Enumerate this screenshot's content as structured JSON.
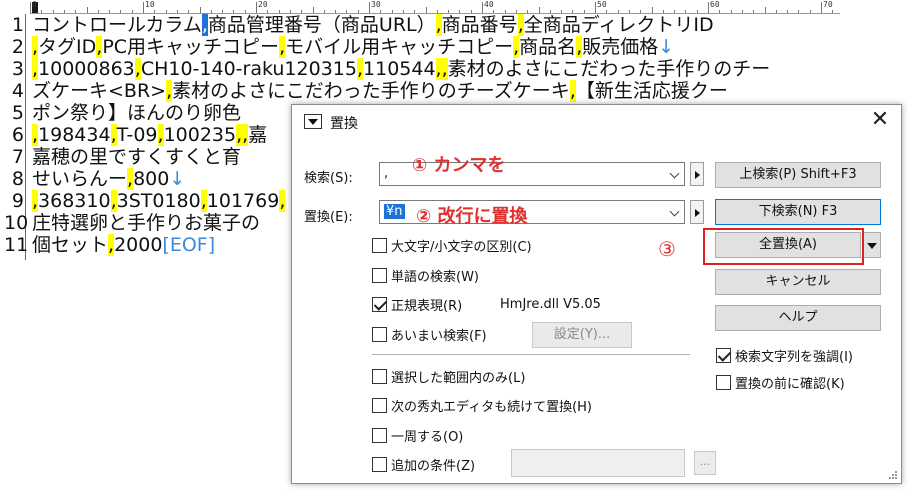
{
  "editor": {
    "ruler_labels": [
      "0",
      "10",
      "20",
      "30",
      "40",
      "50",
      "60",
      "70"
    ],
    "line_numbers": [
      "1",
      "2",
      "3",
      "4",
      "5",
      "6",
      "7",
      "8",
      "9",
      "10",
      "11"
    ],
    "lines": [
      [
        {
          "t": "コントロールカラム"
        },
        {
          "t": ",",
          "c": "sel"
        },
        {
          "t": "商品管理番号（商品URL）"
        },
        {
          "t": ",",
          "c": "hl"
        },
        {
          "t": "商品番号"
        },
        {
          "t": ",",
          "c": "hl"
        },
        {
          "t": "全商品ディレクトリID"
        }
      ],
      [
        {
          "t": ",",
          "c": "hl"
        },
        {
          "t": "タグID"
        },
        {
          "t": ",",
          "c": "hl"
        },
        {
          "t": "PC用キャッチコピー"
        },
        {
          "t": ",",
          "c": "hl"
        },
        {
          "t": "モバイル用キャッチコピー"
        },
        {
          "t": ",",
          "c": "hl"
        },
        {
          "t": "商品名"
        },
        {
          "t": ",",
          "c": "hl"
        },
        {
          "t": "販売価格"
        },
        {
          "t": "↓",
          "c": "nl"
        }
      ],
      [
        {
          "t": ",",
          "c": "hl"
        },
        {
          "t": "10000863"
        },
        {
          "t": ",",
          "c": "hl"
        },
        {
          "t": "CH10-140-raku120315"
        },
        {
          "t": ",",
          "c": "hl"
        },
        {
          "t": "110544"
        },
        {
          "t": ",",
          "c": "hl"
        },
        {
          "t": ",",
          "c": "hl"
        },
        {
          "t": "素材のよさにこだわった手作りのチー"
        }
      ],
      [
        {
          "t": "ズケーキ<BR>"
        },
        {
          "t": ",",
          "c": "hl"
        },
        {
          "t": "素材のよさにこだわった手作りのチーズケーキ"
        },
        {
          "t": ",",
          "c": "hl"
        },
        {
          "t": "【新生活応援クー"
        }
      ],
      [
        {
          "t": "ポン祭り】ほんのり卵色"
        }
      ],
      [
        {
          "t": ",",
          "c": "hl"
        },
        {
          "t": "198434"
        },
        {
          "t": ",",
          "c": "hl"
        },
        {
          "t": "T-09"
        },
        {
          "t": ",",
          "c": "hl"
        },
        {
          "t": "100235"
        },
        {
          "t": ",",
          "c": "hl"
        },
        {
          "t": ",",
          "c": "hl"
        },
        {
          "t": "嘉"
        }
      ],
      [
        {
          "t": "嘉穂の里ですくすくと育"
        }
      ],
      [
        {
          "t": "せいらんー"
        },
        {
          "t": ",",
          "c": "hl"
        },
        {
          "t": "800"
        },
        {
          "t": "↓",
          "c": "nl"
        }
      ],
      [
        {
          "t": ",",
          "c": "hl"
        },
        {
          "t": "368310"
        },
        {
          "t": ",",
          "c": "hl"
        },
        {
          "t": "3ST0180"
        },
        {
          "t": ",",
          "c": "hl"
        },
        {
          "t": "101769"
        },
        {
          "t": ",",
          "c": "hl"
        }
      ],
      [
        {
          "t": "庄特選卵と手作りお菓子の"
        }
      ],
      [
        {
          "t": "個セット"
        },
        {
          "t": ",",
          "c": "hl"
        },
        {
          "t": "2000"
        },
        {
          "t": "[EOF]",
          "c": "eof"
        }
      ]
    ]
  },
  "dialog": {
    "title": "置換",
    "close": "✕",
    "search_label": "検索(S):",
    "search_value": ",",
    "replace_label": "置換(E):",
    "replace_value": "¥n",
    "annotation_1": "① カンマを",
    "annotation_2": "② 改行に置換",
    "annotation_3": "③",
    "buttons": {
      "search_up": "上検索(P) Shift+F3",
      "search_down": "下検索(N) F3",
      "replace_all": "全置換(A)",
      "cancel": "キャンセル",
      "help": "ヘルプ",
      "settings": "設定(Y)...",
      "more": "..."
    },
    "options": {
      "case_sensitive": {
        "label": "大文字/小文字の区別(C)",
        "checked": false
      },
      "whole_word": {
        "label": "単語の検索(W)",
        "checked": false
      },
      "regex": {
        "label": "正規表現(R)",
        "checked": true
      },
      "regex_lib": "HmJre.dll V5.05",
      "fuzzy": {
        "label": "あいまい検索(F)",
        "checked": false
      },
      "selection_only": {
        "label": "選択した範囲内のみ(L)",
        "checked": false
      },
      "continue_next": {
        "label": "次の秀丸エディタも続けて置換(H)",
        "checked": false
      },
      "wrap_around": {
        "label": "一周する(O)",
        "checked": false
      },
      "extra_condition": {
        "label": "追加の条件(Z)",
        "checked": false
      },
      "highlight": {
        "label": "検索文字列を強調(I)",
        "checked": true
      },
      "confirm": {
        "label": "置換の前に確認(K)",
        "checked": false
      }
    }
  }
}
